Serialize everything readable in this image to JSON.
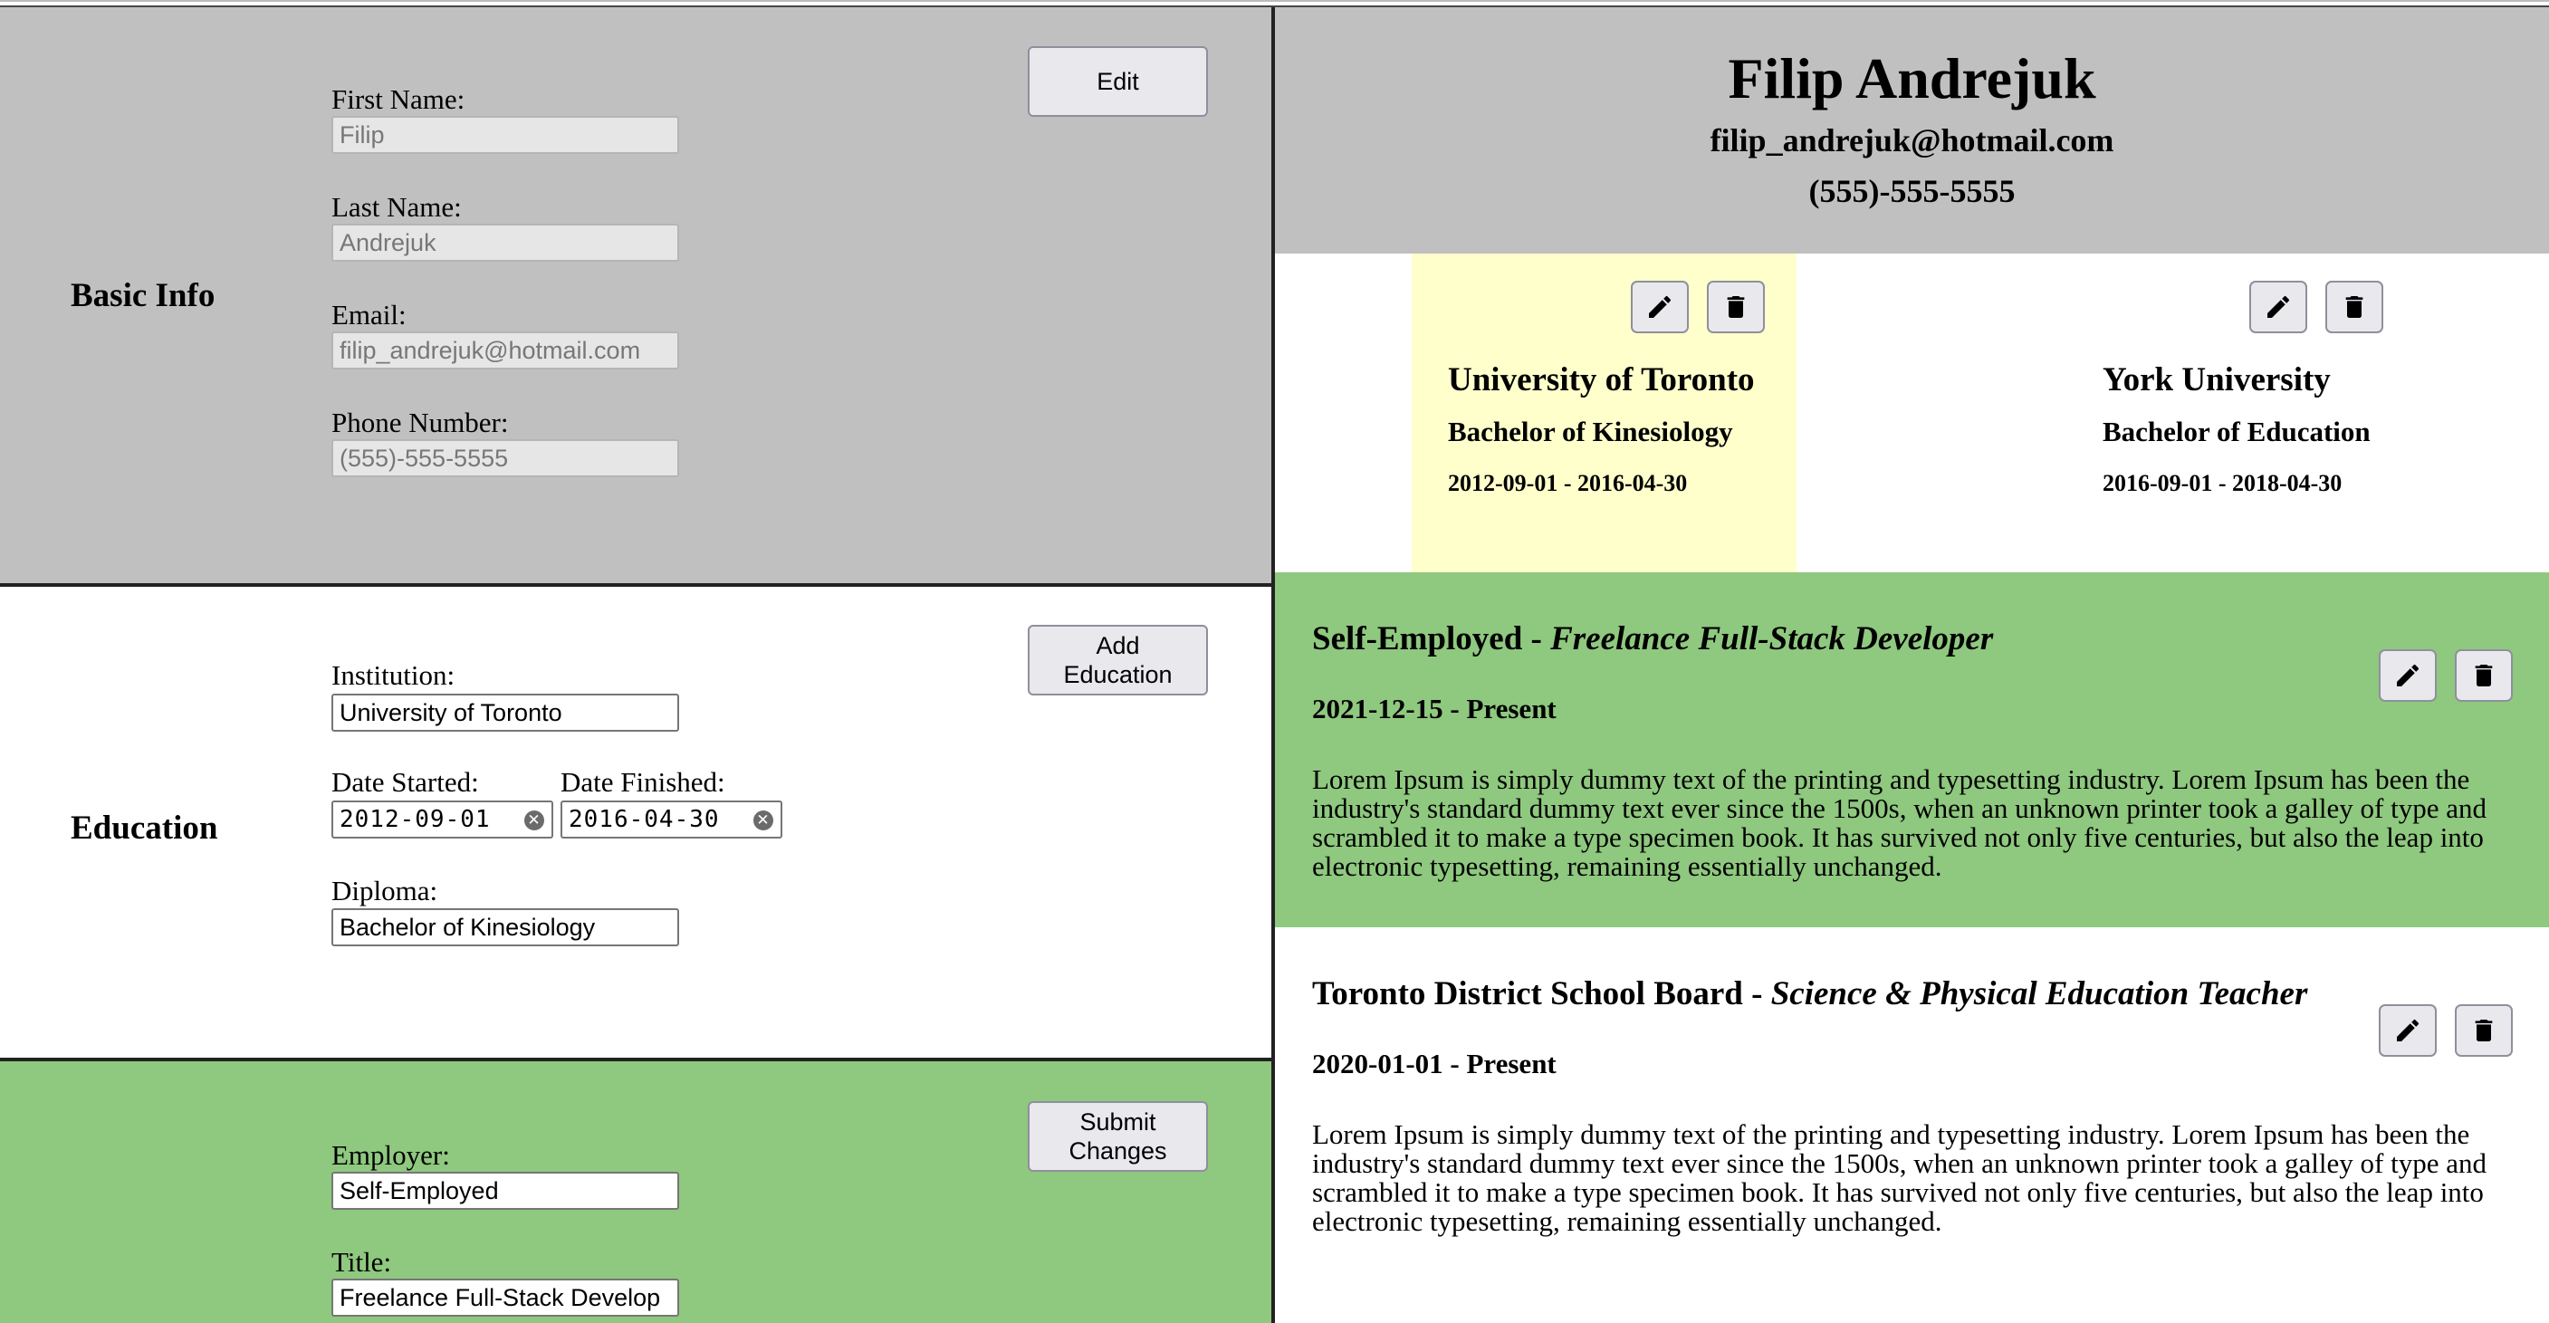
{
  "form": {
    "basic": {
      "title": "Basic Info",
      "button": "Edit",
      "first_name_label": "First Name:",
      "first_name": "Filip",
      "last_name_label": "Last Name:",
      "last_name": "Andrejuk",
      "email_label": "Email:",
      "email": "filip_andrejuk@hotmail.com",
      "phone_label": "Phone Number:",
      "phone": "(555)-555-5555"
    },
    "education": {
      "title": "Education",
      "button_line1": "Add",
      "button_line2": "Education",
      "institution_label": "Institution:",
      "institution": "University of Toronto",
      "date_started_label": "Date Started:",
      "date_started": "2012-09-01",
      "date_finished_label": "Date Finished:",
      "date_finished": "2016-04-30",
      "diploma_label": "Diploma:",
      "diploma": "Bachelor of Kinesiology"
    },
    "experience": {
      "button_line1": "Submit",
      "button_line2": "Changes",
      "employer_label": "Employer:",
      "employer": "Self-Employed",
      "title_label": "Title:",
      "title": "Freelance Full-Stack Develop"
    }
  },
  "resume": {
    "name": "Filip Andrejuk",
    "email": "filip_andrejuk@hotmail.com",
    "phone": "(555)-555-5555",
    "education": [
      {
        "institution": "University of Toronto",
        "degree": "Bachelor of Kinesiology",
        "dates": "2012-09-01 - 2016-04-30",
        "highlighted": true
      },
      {
        "institution": "York University",
        "degree": "Bachelor of Education",
        "dates": "2016-09-01 - 2018-04-30",
        "highlighted": false
      }
    ],
    "experience": [
      {
        "employer": "Self-Employed",
        "separator": " - ",
        "title": "Freelance Full-Stack Developer",
        "dates": "2021-12-15 - Present",
        "description": "Lorem Ipsum is simply dummy text of the printing and typesetting industry. Lorem Ipsum has been the industry's standard dummy text ever since the 1500s, when an unknown printer took a galley of type and scrambled it to make a type specimen book. It has survived not only five centuries, but also the leap into electronic typesetting, remaining essentially unchanged."
      },
      {
        "employer": "Toronto District School Board",
        "separator": " - ",
        "title": "Science & Physical Education Teacher",
        "dates": "2020-01-01 - Present",
        "description": "Lorem Ipsum is simply dummy text of the printing and typesetting industry. Lorem Ipsum has been the industry's standard dummy text ever since the 1500s, when an unknown printer took a galley of type and scrambled it to make a type specimen book. It has survived not only five centuries, but also the leap into electronic typesetting, remaining essentially unchanged."
      }
    ]
  },
  "icons": {
    "edit": "pencil-icon",
    "delete": "trash-icon",
    "clear": "clear-icon"
  },
  "colors": {
    "gray_panel": "#c0c0c0",
    "green_panel": "#8fc87f",
    "highlight": "#ffffcc"
  }
}
